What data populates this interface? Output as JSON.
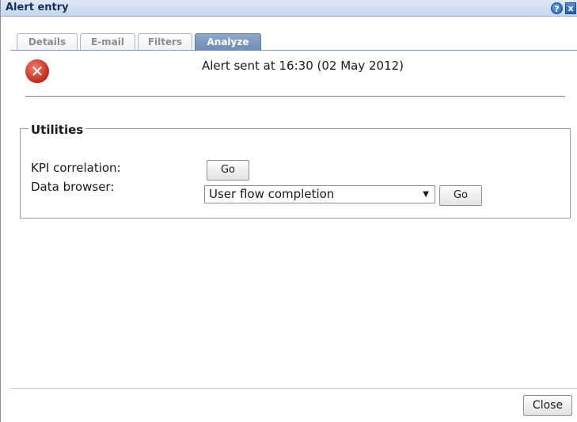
{
  "dialog": {
    "title": "Alert entry",
    "help_icon": "help-icon",
    "close_icon": "close-icon",
    "help_glyph": "?",
    "close_glyph": "x"
  },
  "tabs": [
    {
      "label": "Details",
      "active": false
    },
    {
      "label": "E-mail",
      "active": false
    },
    {
      "label": "Filters",
      "active": false
    },
    {
      "label": "Analyze",
      "active": true
    }
  ],
  "alert": {
    "icon": "error-icon",
    "message": "Alert sent at 16:30 (02 May 2012)"
  },
  "utilities": {
    "legend": "Utilities",
    "kpi_label": "KPI correlation:",
    "kpi_go_label": "Go",
    "browser_label": "Data browser:",
    "browser_selected": "User flow completion",
    "browser_go_label": "Go"
  },
  "footer": {
    "close_label": "Close"
  },
  "colors": {
    "titlebar": "#c6d6ec",
    "active_tab": "#6e8cb7",
    "error": "#c22a1c"
  }
}
